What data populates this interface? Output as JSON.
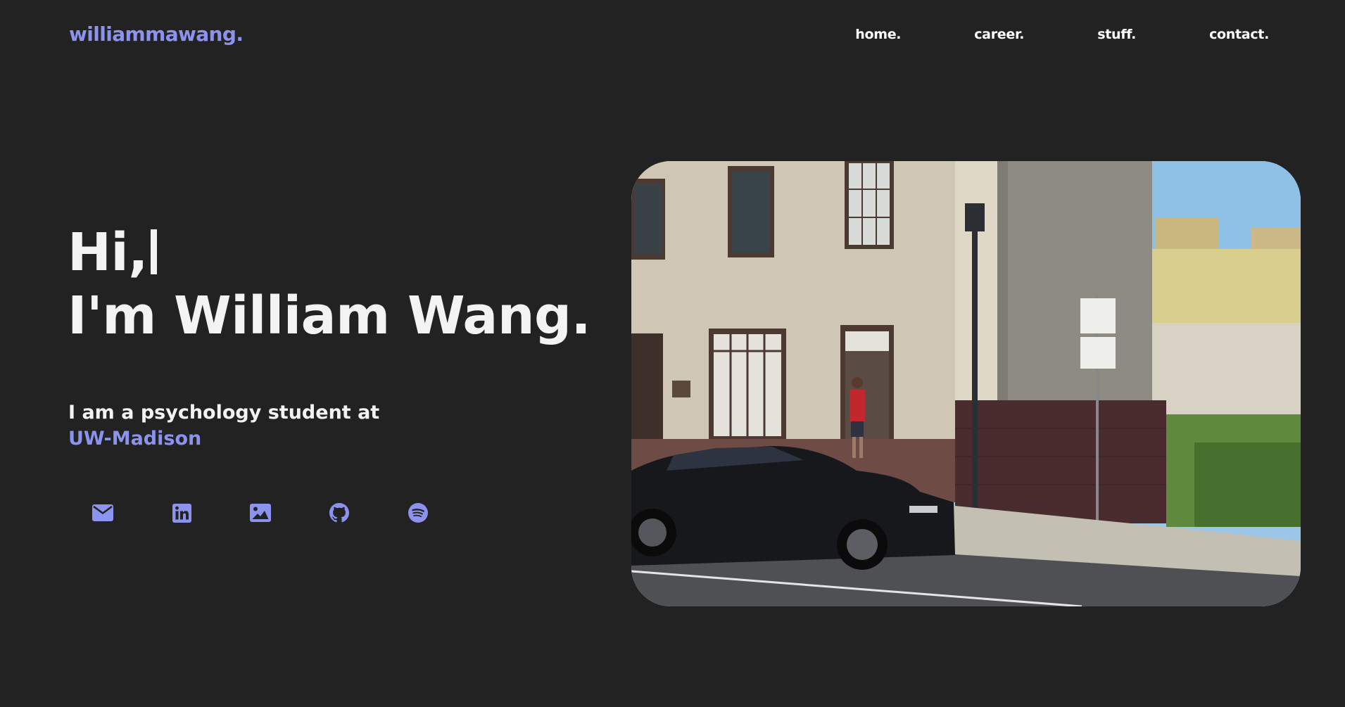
{
  "header": {
    "logo": "williammawang.",
    "nav": [
      {
        "label": "home."
      },
      {
        "label": "career."
      },
      {
        "label": "stuff."
      },
      {
        "label": "contact."
      }
    ]
  },
  "hero": {
    "line1": "Hi,",
    "line2": "I'm William Wang.",
    "intro": "I am a psychology student at",
    "school": "UW-Madison"
  },
  "socials": [
    {
      "icon": "envelope-icon"
    },
    {
      "icon": "linkedin-icon"
    },
    {
      "icon": "image-icon"
    },
    {
      "icon": "github-icon"
    },
    {
      "icon": "spotify-icon"
    }
  ],
  "colors": {
    "background": "#232223",
    "accent": "#8b93ef",
    "text": "#f3f3f3"
  }
}
